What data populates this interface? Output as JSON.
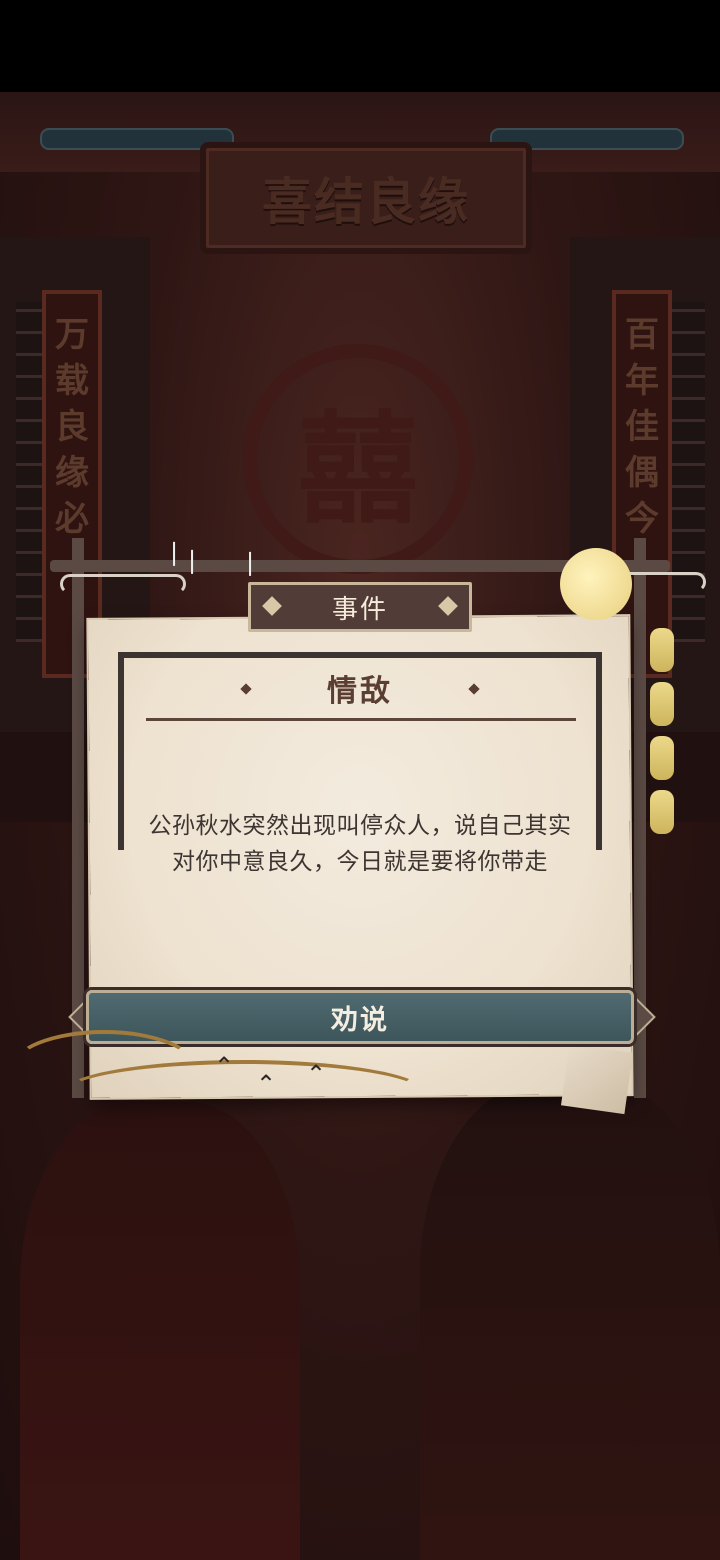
{
  "scene": {
    "banner_text": "喜结良缘",
    "couplet_left": [
      "万",
      "载",
      "良",
      "缘",
      "必"
    ],
    "couplet_right": [
      "百",
      "年",
      "佳",
      "偶",
      "今"
    ],
    "center_symbol": "囍"
  },
  "event": {
    "tag_label": "事件",
    "title": "情敌",
    "description": "公孙秋水突然出现叫停众人，说自己其实对你中意良久，今日就是要将你带走",
    "action_label": "劝说"
  }
}
